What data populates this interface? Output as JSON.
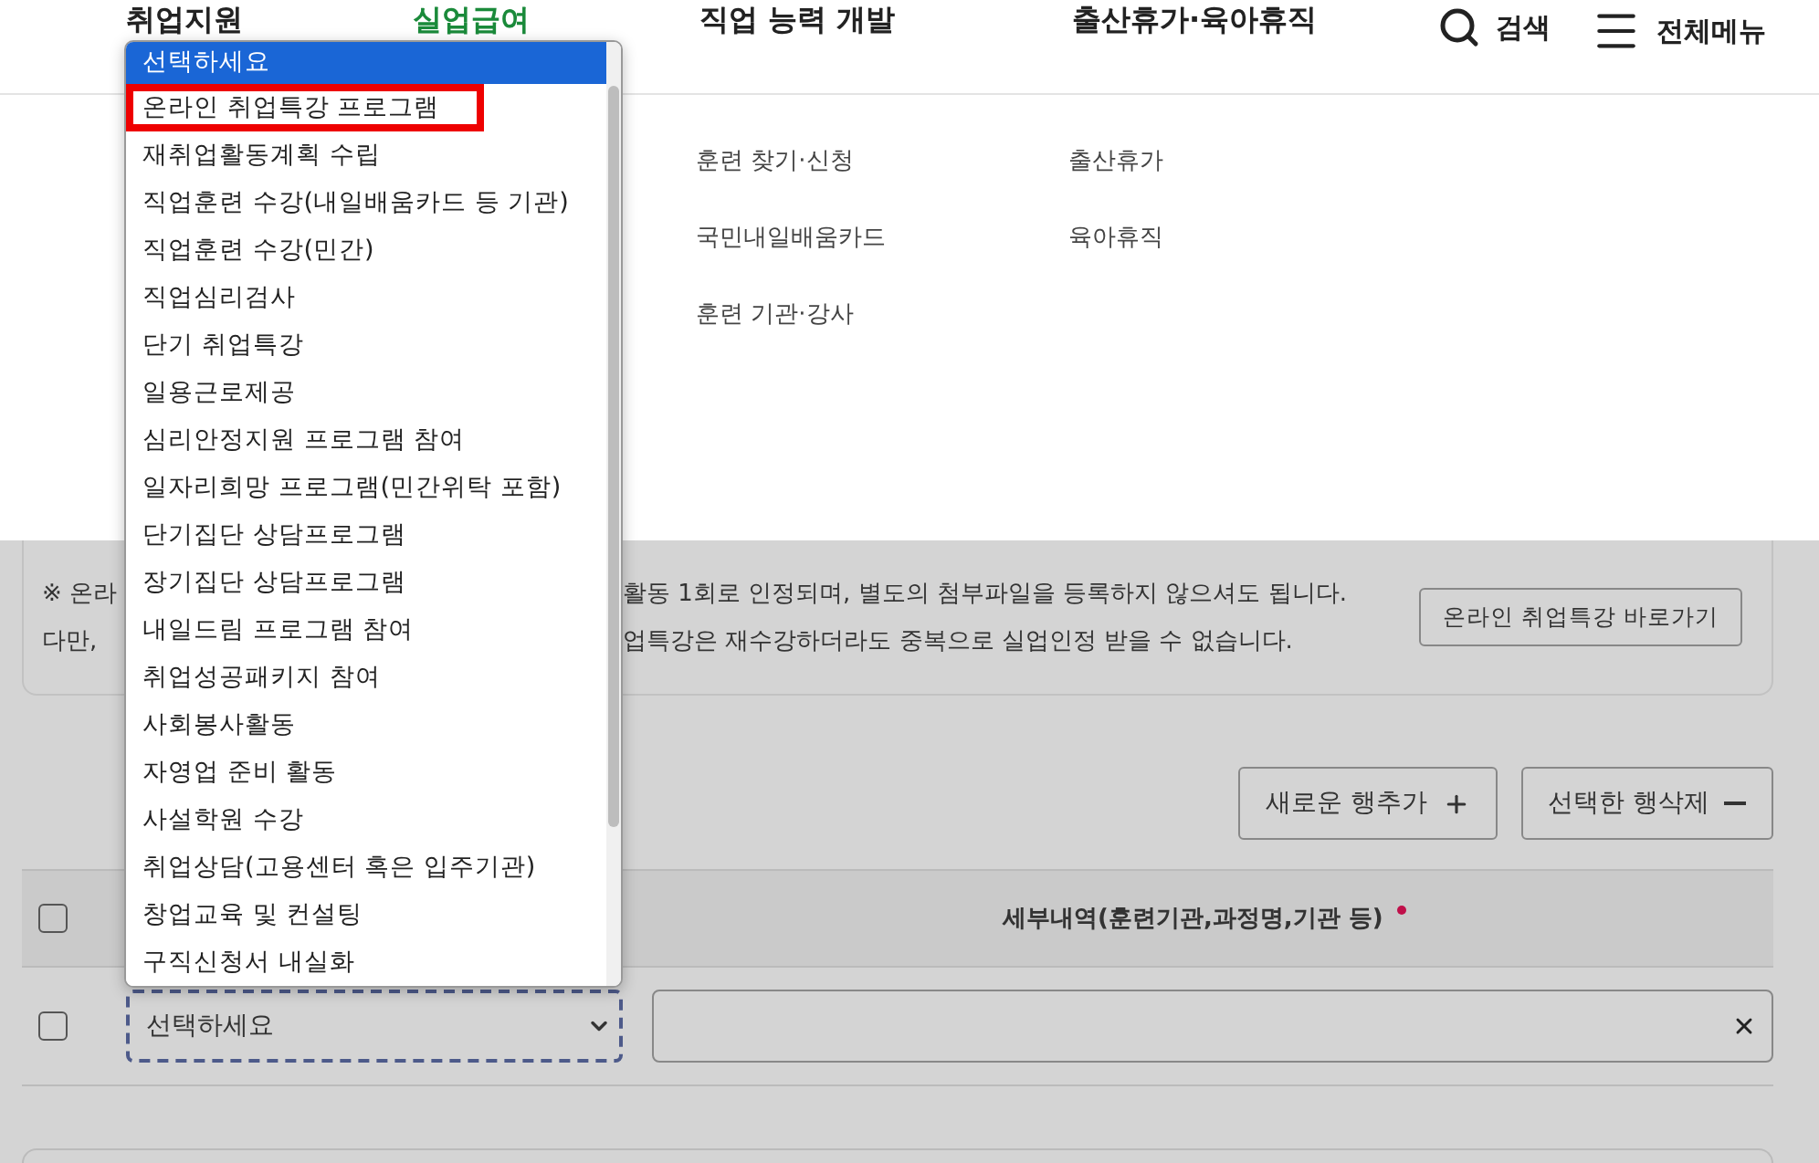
{
  "nav": [
    {
      "label": "취업지원",
      "selected": false
    },
    {
      "label": "실업급여",
      "selected": true
    },
    {
      "label": "직업 능력 개발",
      "selected": false
    },
    {
      "label": "출산휴가·육아휴직",
      "selected": false
    }
  ],
  "search": {
    "label": "검색"
  },
  "all_menu": {
    "label": "전체메뉴"
  },
  "submenu_columns": [
    {
      "items": [
        "훈련 찾기·신청",
        "국민내일배움카드",
        "훈련 기관·강사"
      ]
    },
    {
      "items": [
        "출산휴가",
        "육아휴직"
      ]
    }
  ],
  "notice": {
    "lines": [
      {
        "left": "※ 온라",
        "right": "활동 1회로 인정되며, 별도의 첨부파일을 등록하지 않으셔도 됩니다."
      },
      {
        "left": "다만,",
        "right": "업특강은 재수강하더라도 중복으로 실업인정 받을 수 없습니다."
      }
    ],
    "button": "온라인 취업특강 바로가기"
  },
  "actions": [
    {
      "label": "새로운 행추가",
      "kind": "add"
    },
    {
      "label": "선택한 행삭제",
      "kind": "remove"
    }
  ],
  "table": {
    "header": {
      "checked": false,
      "column_3": "세부내역(훈련기관,과정명,기관 등)",
      "required": true
    },
    "rows": [
      {
        "checked": false,
        "select_value": "선택하세요",
        "focused": true
      }
    ]
  },
  "dropdown": {
    "options": [
      {
        "label": "선택하세요",
        "selected": true,
        "highlighted": false
      },
      {
        "label": "온라인 취업특강 프로그램",
        "selected": false,
        "highlighted": true
      },
      {
        "label": "재취업활동계획 수립",
        "selected": false,
        "highlighted": false
      },
      {
        "label": "직업훈련 수강(내일배움카드 등 기관)",
        "selected": false,
        "highlighted": false
      },
      {
        "label": "직업훈련 수강(민간)",
        "selected": false,
        "highlighted": false
      },
      {
        "label": "직업심리검사",
        "selected": false,
        "highlighted": false
      },
      {
        "label": "단기 취업특강",
        "selected": false,
        "highlighted": false
      },
      {
        "label": "일용근로제공",
        "selected": false,
        "highlighted": false
      },
      {
        "label": "심리안정지원 프로그램 참여",
        "selected": false,
        "highlighted": false
      },
      {
        "label": "일자리희망 프로그램(민간위탁 포함)",
        "selected": false,
        "highlighted": false
      },
      {
        "label": "단기집단 상담프로그램",
        "selected": false,
        "highlighted": false
      },
      {
        "label": "장기집단 상담프로그램",
        "selected": false,
        "highlighted": false
      },
      {
        "label": "내일드림 프로그램 참여",
        "selected": false,
        "highlighted": false
      },
      {
        "label": "취업성공패키지 참여",
        "selected": false,
        "highlighted": false
      },
      {
        "label": "사회봉사활동",
        "selected": false,
        "highlighted": false
      },
      {
        "label": "자영업 준비 활동",
        "selected": false,
        "highlighted": false
      },
      {
        "label": "사설학원 수강",
        "selected": false,
        "highlighted": false
      },
      {
        "label": "취업상담(고용센터 혹은 입주기관)",
        "selected": false,
        "highlighted": false
      },
      {
        "label": "창업교육 및 컨설팅",
        "selected": false,
        "highlighted": false
      },
      {
        "label": "구직신청서 내실화",
        "selected": false,
        "highlighted": false
      }
    ]
  }
}
